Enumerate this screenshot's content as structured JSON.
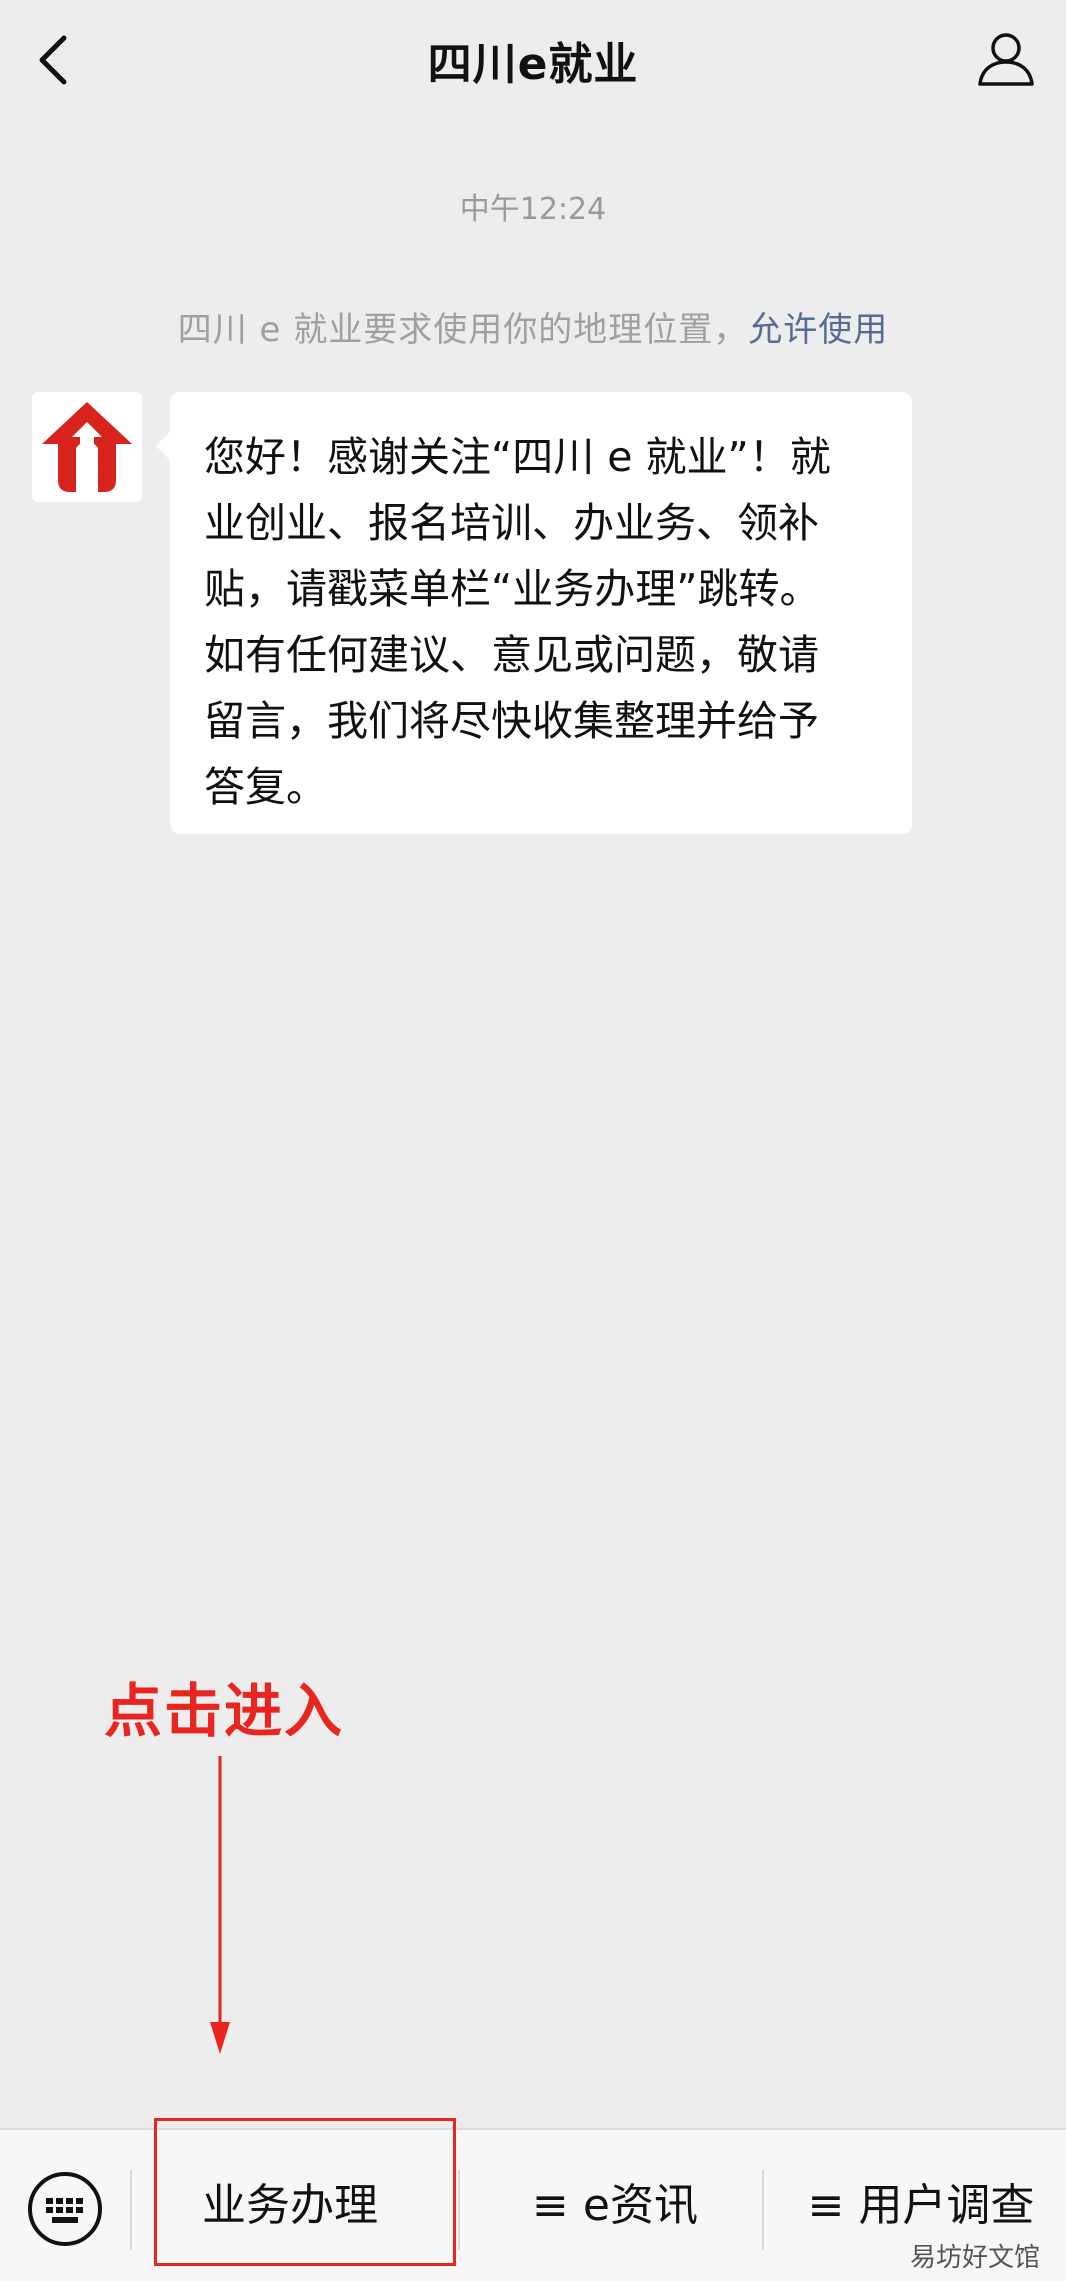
{
  "header": {
    "title": "四川e就业",
    "back_icon": "chevron-left-icon",
    "profile_icon": "person-icon"
  },
  "chat": {
    "timestamp": "中午12:24",
    "location_notice": {
      "text": "四川 e 就业要求使用你的地理位置，",
      "link": "允许使用"
    },
    "message": {
      "avatar_icon": "sichuan-e-jiuye-logo",
      "lines": [
        "您好！感谢关注“四川 e 就业”！就",
        "业创业、报名培训、办业务、领补",
        "贴，请戳菜单栏“业务办理”跳转。",
        "如有任何建议、意见或问题，敬请",
        "留言，我们将尽快收集整理并给予",
        "答复。"
      ]
    }
  },
  "annotation": {
    "text": "点击进入",
    "color": "#e8261f"
  },
  "menu": {
    "keyboard_icon": "keyboard-icon",
    "items": [
      {
        "label": "业务办理"
      },
      {
        "prefix": "≡",
        "label": "e资讯"
      },
      {
        "prefix": "≡",
        "label": "用户调查"
      }
    ]
  },
  "watermark": "易坊好文馆",
  "colors": {
    "background": "#ededed",
    "link": "#576b95",
    "brand_red": "#d7231c",
    "annotation_red": "#e8261f"
  }
}
